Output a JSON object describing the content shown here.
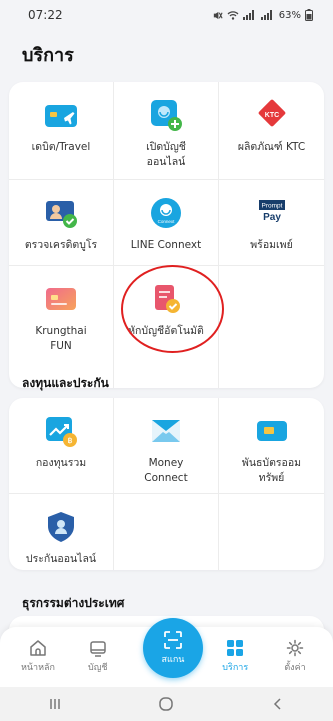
{
  "status_bar": {
    "time": "07:22",
    "battery": "63%"
  },
  "page": {
    "title": "บริการ"
  },
  "services": [
    {
      "label": "เดบิต/Travel",
      "icon": "travel-card-icon"
    },
    {
      "label": "เปิดบัญชี\nออนไลน์",
      "icon": "open-account-icon"
    },
    {
      "label": "ผลิตภัณฑ์ KTC",
      "icon": "ktc-icon",
      "badge": "KTC"
    },
    {
      "label": "ตรวจเครดิตบูโร",
      "icon": "credit-bureau-icon"
    },
    {
      "label": "LINE Connext",
      "icon": "line-connext-icon",
      "badge": "Connext"
    },
    {
      "label": "พร้อมเพย์",
      "icon": "promptpay-icon",
      "badge_top": "Prompt",
      "badge_bottom": "Pay"
    },
    {
      "label": "Krungthai\nFUN",
      "icon": "krungthai-fun-icon"
    },
    {
      "label": "หักบัญชีอัตโนมัติ",
      "icon": "auto-debit-icon"
    }
  ],
  "investment": {
    "title": "ลงทุนและประกัน",
    "items": [
      {
        "label": "กองทุนรวม",
        "icon": "mutual-fund-icon",
        "badge": "฿"
      },
      {
        "label": "Money\nConnect",
        "icon": "money-connect-icon"
      },
      {
        "label": "พันธบัตรออม\nทรัพย์",
        "icon": "savings-bond-icon"
      },
      {
        "label": "ประกันออนไลน์",
        "icon": "online-insurance-icon"
      }
    ]
  },
  "foreign": {
    "title": "ธุรกรรมต่างประเทศ"
  },
  "bottom_nav": {
    "home": "หน้าหลัก",
    "account": "บัญชี",
    "scan": "สแกน",
    "services": "บริการ",
    "settings": "ตั้งค่า"
  },
  "colors": {
    "accent": "#1aa5e6",
    "highlight": "#e02020"
  }
}
